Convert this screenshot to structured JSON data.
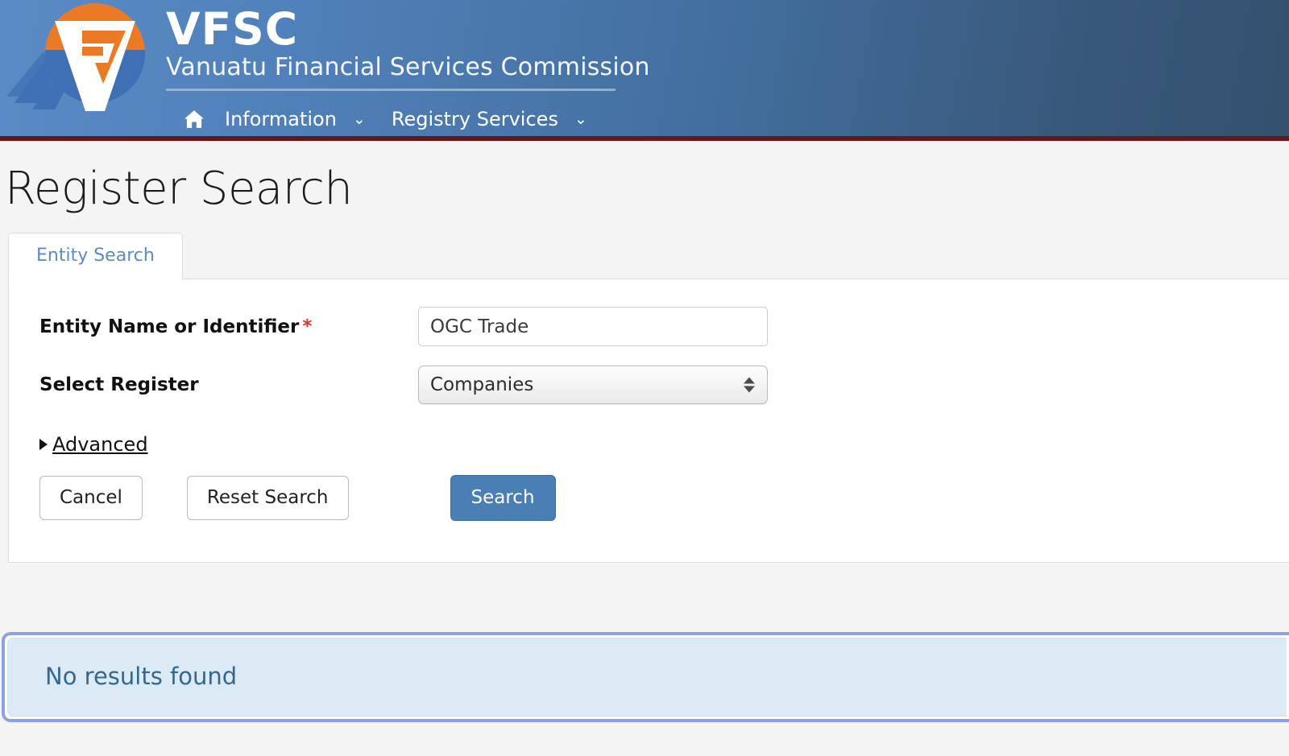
{
  "header": {
    "logo_icon": "vfsc-logo-icon",
    "brand_title": "VFSC",
    "brand_subtitle": "Vanuatu Financial Services Commission",
    "accent_color": "#6b1616",
    "bg_gradient_from": "#5a8bc4",
    "bg_gradient_to": "#33516f",
    "nav": {
      "home_icon": "home-icon",
      "items": [
        {
          "label": "Information",
          "caret": "⌄"
        },
        {
          "label": "Registry Services",
          "caret": "⌄"
        }
      ]
    }
  },
  "page": {
    "title": "Register Search",
    "background": "#f4f4f4"
  },
  "tabs": [
    {
      "label": "Entity Search",
      "active": true
    }
  ],
  "form": {
    "fields": [
      {
        "label": "Entity Name or Identifier",
        "required_marker": "*",
        "required_color": "#d9342b",
        "value": "OGC Trade",
        "placeholder": "Entity Name or Identifier"
      },
      {
        "label": "Select Register",
        "required_marker": "",
        "value": "Companies",
        "options": [
          "Companies"
        ]
      }
    ],
    "advanced": {
      "label": "Advanced",
      "expanded": false,
      "disclosure_icon": "disclosure-triangle-icon"
    },
    "buttons": {
      "cancel": "Cancel",
      "reset": "Reset Search",
      "search": "Search",
      "search_color": "#4a7fb5"
    }
  },
  "results": {
    "message": "No results found",
    "message_color": "#35688f",
    "fill_color": "#dceaf6",
    "outline_color": "#8ca2e6"
  }
}
